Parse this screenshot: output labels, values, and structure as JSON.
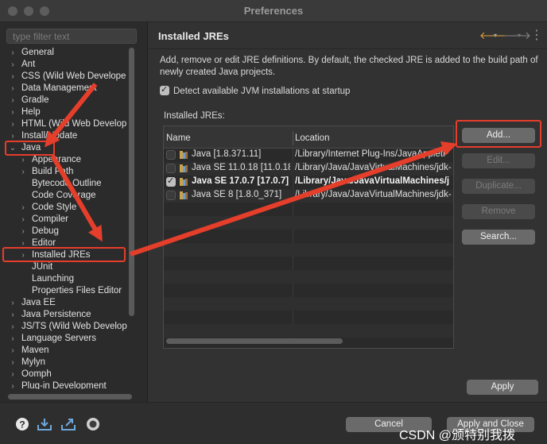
{
  "window": {
    "title": "Preferences"
  },
  "sidebar": {
    "filter_placeholder": "type filter text",
    "items": [
      {
        "label": "General",
        "indent": 0,
        "arrow": "›"
      },
      {
        "label": "Ant",
        "indent": 0,
        "arrow": "›"
      },
      {
        "label": "CSS (Wild Web Develope",
        "indent": 0,
        "arrow": "›"
      },
      {
        "label": "Data Management",
        "indent": 0,
        "arrow": "›"
      },
      {
        "label": "Gradle",
        "indent": 0,
        "arrow": "›"
      },
      {
        "label": "Help",
        "indent": 0,
        "arrow": "›"
      },
      {
        "label": "HTML (Wild Web Develop",
        "indent": 0,
        "arrow": "›"
      },
      {
        "label": "Install/Update",
        "indent": 0,
        "arrow": "›"
      },
      {
        "label": "Java",
        "indent": 0,
        "arrow": "⌄"
      },
      {
        "label": "Appearance",
        "indent": 1,
        "arrow": "›"
      },
      {
        "label": "Build Path",
        "indent": 1,
        "arrow": "›"
      },
      {
        "label": "Bytecode Outline",
        "indent": 1,
        "arrow": ""
      },
      {
        "label": "Code Coverage",
        "indent": 1,
        "arrow": ""
      },
      {
        "label": "Code Style",
        "indent": 1,
        "arrow": "›"
      },
      {
        "label": "Compiler",
        "indent": 1,
        "arrow": "›"
      },
      {
        "label": "Debug",
        "indent": 1,
        "arrow": "›"
      },
      {
        "label": "Editor",
        "indent": 1,
        "arrow": "›"
      },
      {
        "label": "Installed JREs",
        "indent": 1,
        "arrow": "›"
      },
      {
        "label": "JUnit",
        "indent": 1,
        "arrow": ""
      },
      {
        "label": "Launching",
        "indent": 1,
        "arrow": ""
      },
      {
        "label": "Properties Files Editor",
        "indent": 1,
        "arrow": ""
      },
      {
        "label": "Java EE",
        "indent": 0,
        "arrow": "›"
      },
      {
        "label": "Java Persistence",
        "indent": 0,
        "arrow": "›"
      },
      {
        "label": "JS/TS (Wild Web Develop",
        "indent": 0,
        "arrow": "›"
      },
      {
        "label": "Language Servers",
        "indent": 0,
        "arrow": "›"
      },
      {
        "label": "Maven",
        "indent": 0,
        "arrow": "›"
      },
      {
        "label": "Mylyn",
        "indent": 0,
        "arrow": "›"
      },
      {
        "label": "Oomph",
        "indent": 0,
        "arrow": "›"
      },
      {
        "label": "Plug-in Development",
        "indent": 0,
        "arrow": "›"
      }
    ]
  },
  "main": {
    "title": "Installed JREs",
    "description": "Add, remove or edit JRE definitions. By default, the checked JRE is added to the build path of newly created Java projects.",
    "detect_label": "Detect available JVM installations at startup",
    "detect_checked": true,
    "table_label": "Installed JREs:",
    "columns": {
      "name": "Name",
      "location": "Location"
    },
    "rows": [
      {
        "checked": false,
        "bold": false,
        "name": "Java [1.8.371.11]",
        "location": "/Library/Internet Plug-Ins/JavaAppletP"
      },
      {
        "checked": false,
        "bold": false,
        "name": "Java SE 11.0.18 [11.0.18]",
        "location": "/Library/Java/JavaVirtualMachines/jdk-"
      },
      {
        "checked": true,
        "bold": true,
        "name": "Java SE 17.0.7 [17.0.7] (",
        "location": "/Library/Java/JavaVirtualMachines/j"
      },
      {
        "checked": false,
        "bold": false,
        "name": "Java SE 8 [1.8.0_371]",
        "location": "/Library/Java/JavaVirtualMachines/jdk-"
      }
    ],
    "buttons": {
      "add": "Add...",
      "edit": "Edit...",
      "duplicate": "Duplicate...",
      "remove": "Remove",
      "search": "Search...",
      "apply": "Apply"
    }
  },
  "footer": {
    "cancel": "Cancel",
    "apply_close": "Apply and Close",
    "watermark": "CSDN @颁特别我拨"
  },
  "colors": {
    "annotation": "#e53e2b",
    "nav_back": "#e8a33a"
  }
}
